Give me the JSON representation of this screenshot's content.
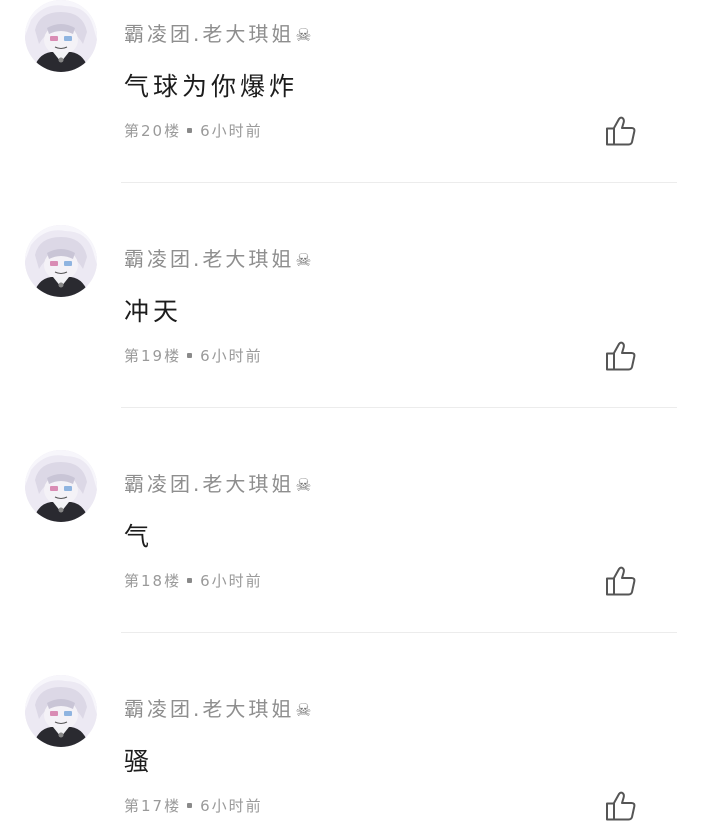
{
  "comments": [
    {
      "username": "霸凌团.老大琪姐",
      "username_emoji": "☠",
      "content": "气球为你爆炸",
      "floor": "第20楼",
      "time": "6小时前",
      "avatar_icon": "anime-avatar-icon",
      "like_icon": "thumbs-up-icon"
    },
    {
      "username": "霸凌团.老大琪姐",
      "username_emoji": "☠",
      "content": "冲天",
      "floor": "第19楼",
      "time": "6小时前",
      "avatar_icon": "anime-avatar-icon",
      "like_icon": "thumbs-up-icon"
    },
    {
      "username": "霸凌团.老大琪姐",
      "username_emoji": "☠",
      "content": "气",
      "floor": "第18楼",
      "time": "6小时前",
      "avatar_icon": "anime-avatar-icon",
      "like_icon": "thumbs-up-icon"
    },
    {
      "username": "霸凌团.老大琪姐",
      "username_emoji": "☠",
      "content": "骚",
      "floor": "第17楼",
      "time": "6小时前",
      "avatar_icon": "anime-avatar-icon",
      "like_icon": "thumbs-up-icon"
    }
  ],
  "colors": {
    "username": "#8e8e8e",
    "content": "#1c1c1c",
    "meta": "#9a9a9a",
    "divider": "#ececec",
    "icon": "#555555"
  }
}
